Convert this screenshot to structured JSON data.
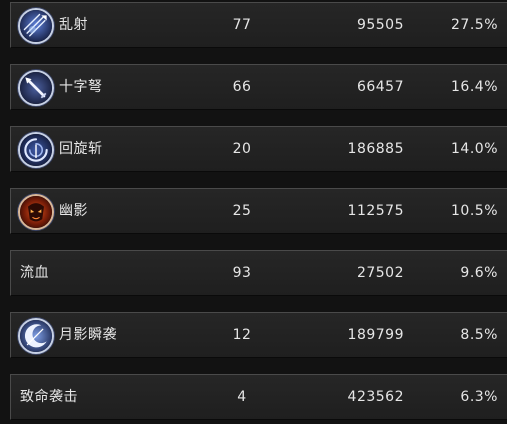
{
  "skills": [
    {
      "name": "乱射",
      "hits": "77",
      "damage": "95505",
      "percent": "27.5%",
      "icon": "arrow-volley-icon"
    },
    {
      "name": "十字弩",
      "hits": "66",
      "damage": "66457",
      "percent": "16.4%",
      "icon": "crossbow-bolt-icon"
    },
    {
      "name": "回旋斩",
      "hits": "20",
      "damage": "186885",
      "percent": "14.0%",
      "icon": "spinning-slash-icon"
    },
    {
      "name": "幽影",
      "hits": "25",
      "damage": "112575",
      "percent": "10.5%",
      "icon": "shadow-demon-icon"
    },
    {
      "name": "流血",
      "hits": "93",
      "damage": "27502",
      "percent": "9.6%",
      "icon": null
    },
    {
      "name": "月影瞬袭",
      "hits": "12",
      "damage": "189799",
      "percent": "8.5%",
      "icon": "moon-strike-icon"
    },
    {
      "name": "致命袭击",
      "hits": "4",
      "damage": "423562",
      "percent": "6.3%",
      "icon": null
    }
  ],
  "colors": {
    "row_background": "#232323",
    "text": "#e6e6e6",
    "icon_border": "#c7d1e6",
    "page_background": "#121212"
  }
}
